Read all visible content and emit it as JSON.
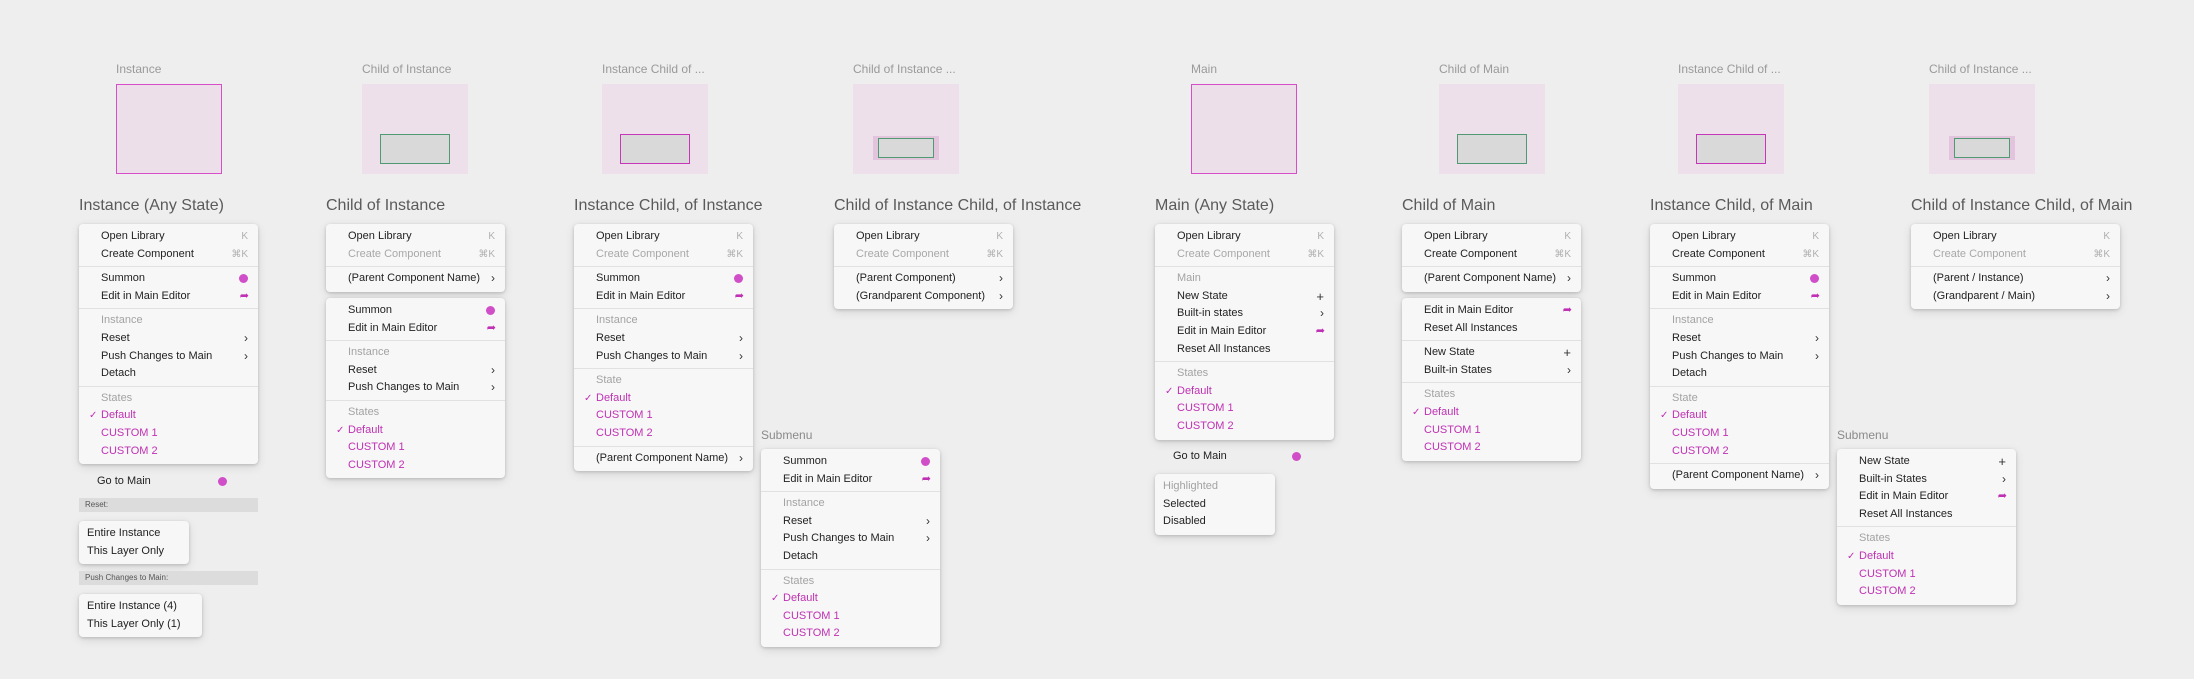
{
  "thumbs": [
    {
      "label": "Instance"
    },
    {
      "label": "Child of Instance"
    },
    {
      "label": "Instance Child of ..."
    },
    {
      "label": "Child of Instance ..."
    },
    {
      "label": "Main"
    },
    {
      "label": "Child of Main"
    },
    {
      "label": "Instance Child of ..."
    },
    {
      "label": "Child of Instance ..."
    }
  ],
  "sections": {
    "s1": "Instance (Any State)",
    "s2": "Child of Instance",
    "s3": "Instance Child, of Instance",
    "s4": "Child of Instance Child, of Instance",
    "s5": "Main (Any State)",
    "s6": "Child of Main",
    "s7": "Instance Child, of Main",
    "s8": "Child of Instance Child, of Main"
  },
  "common": {
    "open_library": "Open Library",
    "open_library_key": "K",
    "create_component": "Create Component",
    "create_component_key": "⌘K",
    "summon": "Summon",
    "edit_main": "Edit in Main Editor",
    "instance_header": "Instance",
    "reset": "Reset",
    "push_changes": "Push Changes to Main",
    "detach": "Detach",
    "states_header": "States",
    "state_header": "State",
    "default": "Default",
    "custom1": "CUSTOM 1",
    "custom2": "CUSTOM 2",
    "parent_component": "(Parent Component Name)",
    "parent_component_short": "(Parent Component)",
    "grandparent_component": "(Grandparent Component)",
    "main_header": "Main",
    "new_state": "New State",
    "builtin_states": "Built-in States",
    "builtin_states_lower": "Built-in states",
    "reset_all": "Reset All Instances",
    "parent_instance": "(Parent / Instance)",
    "grandparent_main": "(Grandparent / Main)",
    "check": "✓",
    "chevron": "›",
    "plus": "+",
    "arrow": "➦"
  },
  "go_to_main": "Go to Main",
  "reset_bar": "Reset:",
  "push_bar": "Push Changes to Main:",
  "reset_menu": {
    "entire": "Entire Instance",
    "layer": "This Layer Only"
  },
  "push_menu": {
    "entire": "Entire Instance (4)",
    "layer": "This Layer Only (1)"
  },
  "submenu_label": "Submenu",
  "highlight_menu": {
    "highlighted": "Highlighted",
    "selected": "Selected",
    "disabled": "Disabled"
  }
}
